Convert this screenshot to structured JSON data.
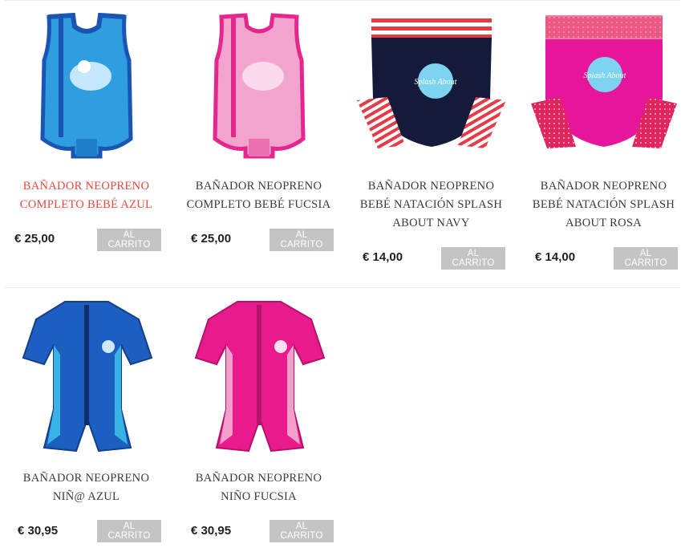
{
  "products": [
    {
      "title_line1": "BAÑADOR NEOPRENO",
      "title_line2": "COMPLETO BEBÉ AZUL",
      "title_line3": "",
      "price": "€ 25,00",
      "cart_label": "AL CARRITO",
      "highlight": true,
      "icon": "baby-wetsuit-blue"
    },
    {
      "title_line1": "BAÑADOR NEOPRENO",
      "title_line2": "COMPLETO BEBÉ FUCSIA",
      "title_line3": "",
      "price": "€ 25,00",
      "cart_label": "AL CARRITO",
      "highlight": false,
      "icon": "baby-wetsuit-fuchsia"
    },
    {
      "title_line1": "BAÑADOR NEOPRENO",
      "title_line2": "BEBÉ NATACIÓN SPLASH",
      "title_line3": "ABOUT NAVY",
      "price": "€ 14,00",
      "cart_label": "AL CARRITO",
      "highlight": false,
      "icon": "swim-nappy-navy"
    },
    {
      "title_line1": "BAÑADOR NEOPRENO",
      "title_line2": "BEBÉ NATACIÓN SPLASH",
      "title_line3": "ABOUT ROSA",
      "price": "€ 14,00",
      "cart_label": "AL CARRITO",
      "highlight": false,
      "icon": "swim-nappy-pink"
    },
    {
      "title_line1": "BAÑADOR NEOPRENO",
      "title_line2": "NIÑ@ AZUL",
      "title_line3": "",
      "price": "€ 30,95",
      "cart_label": "AL CARRITO",
      "highlight": false,
      "icon": "shorty-wetsuit-blue"
    },
    {
      "title_line1": "BAÑADOR NEOPRENO",
      "title_line2": "NIÑO FUCSIA",
      "title_line3": "",
      "price": "€ 30,95",
      "cart_label": "AL CARRITO",
      "highlight": false,
      "icon": "shorty-wetsuit-fuchsia"
    }
  ],
  "logo_text": "Splash About",
  "colors": {
    "highlight": "#e8483f",
    "button": "#c4c4c4",
    "title": "#3a3a3a"
  }
}
